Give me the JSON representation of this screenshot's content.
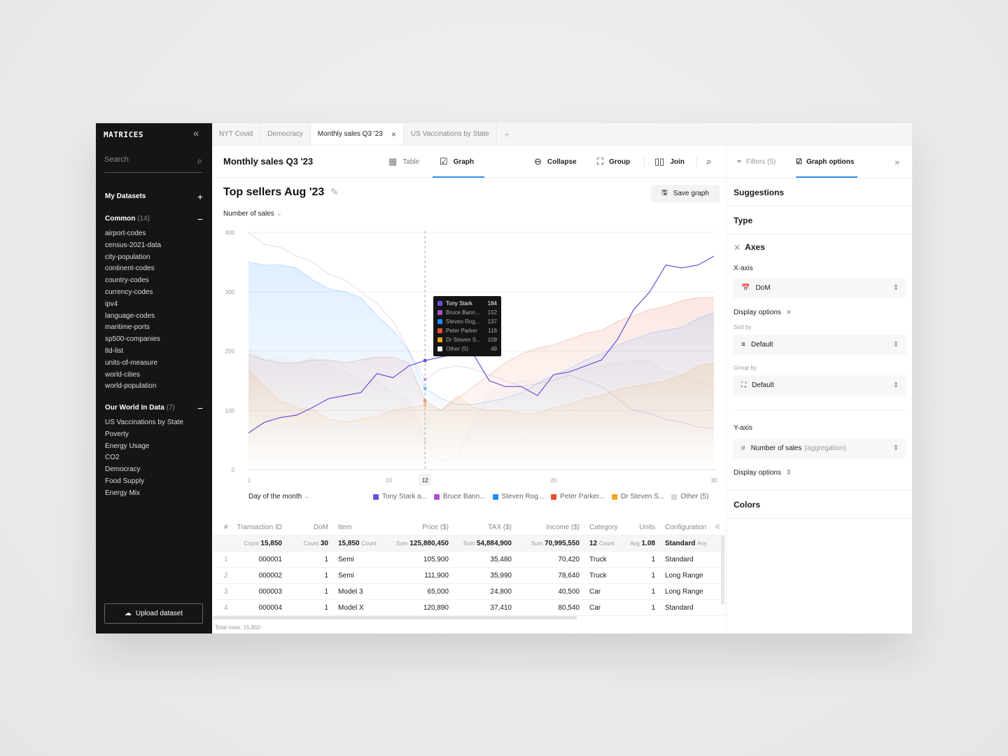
{
  "sidebar": {
    "logo": "MATRICES",
    "search_placeholder": "Search",
    "my_datasets": "My Datasets",
    "groups": [
      {
        "name": "Common",
        "count": "(14)",
        "items": [
          "airport-codes",
          "census-2021-data",
          "city-population",
          "continent-codes",
          "country-codes",
          "currency-codes",
          "ipv4",
          "language-codes",
          "maritime-ports",
          "sp500-companies",
          "tld-list",
          "units-of-measure",
          "world-cities",
          "world-population"
        ]
      },
      {
        "name": "Our World In Data",
        "count": "(7)",
        "items": [
          "US Vaccinations by State",
          "Poverty",
          "Energy Usage",
          "CO2",
          "Democracy",
          "Food Supply",
          "Energy Mix"
        ]
      }
    ],
    "upload": "Upload dataset"
  },
  "tabs": [
    "NYT Covid",
    "Democracy",
    "Monthly sales Q3 '23",
    "US Vaccinations by State"
  ],
  "header": {
    "title": "Monthly sales Q3 '23",
    "table": "Table",
    "graph": "Graph",
    "collapse": "Collapse",
    "group": "Group",
    "join": "Join"
  },
  "graph": {
    "title": "Top sellers Aug '23",
    "save": "Save graph",
    "y_selector": "Number of sales",
    "x_selector": "Day of the month"
  },
  "chart_data": {
    "type": "area",
    "ylim": [
      0,
      400
    ],
    "yticks": [
      "0",
      "100",
      "200",
      "300",
      "400"
    ],
    "xlim": [
      1,
      30
    ],
    "xticks": [
      "1",
      "10",
      "12",
      "20",
      "30"
    ],
    "highlight_x": 12,
    "grid": true,
    "legend": "bottom",
    "x": [
      1,
      2,
      3,
      4,
      5,
      6,
      7,
      8,
      9,
      10,
      11,
      12,
      13,
      14,
      15,
      16,
      17,
      18,
      19,
      20,
      21,
      22,
      23,
      24,
      25,
      26,
      27,
      28,
      29,
      30
    ],
    "series": [
      {
        "name": "Tony Stark",
        "legend": "Tony Stark a...",
        "tip": "Tony Stark",
        "color": "#6a4fd8",
        "values": [
          62,
          80,
          88,
          92,
          105,
          120,
          125,
          130,
          162,
          155,
          175,
          184,
          190,
          195,
          195,
          150,
          140,
          140,
          125,
          160,
          165,
          175,
          185,
          220,
          270,
          300,
          345,
          340,
          345,
          360
        ]
      },
      {
        "name": "Bruce Banner",
        "legend": "Bruce Bann...",
        "tip": "Bruce Bann...",
        "color": "#b04fc8",
        "values": [
          400,
          380,
          375,
          360,
          350,
          330,
          320,
          300,
          280,
          250,
          200,
          152,
          170,
          175,
          170,
          160,
          150,
          140,
          145,
          150,
          160,
          150,
          140,
          120,
          100,
          95,
          85,
          80,
          72,
          70
        ]
      },
      {
        "name": "Steven Rogers",
        "legend": "Steven Rog...",
        "tip": "Steven Rog...",
        "color": "#1a8cff",
        "values": [
          350,
          345,
          345,
          340,
          320,
          305,
          300,
          290,
          260,
          235,
          200,
          137,
          120,
          110,
          110,
          115,
          120,
          130,
          145,
          160,
          170,
          185,
          195,
          210,
          220,
          230,
          235,
          240,
          255,
          265
        ]
      },
      {
        "name": "Peter Parker",
        "legend": "Peter Parker...",
        "tip": "Peter Parker",
        "color": "#e5502e",
        "values": [
          195,
          185,
          180,
          180,
          185,
          185,
          180,
          185,
          190,
          190,
          180,
          116,
          100,
          120,
          140,
          160,
          180,
          195,
          205,
          210,
          220,
          230,
          235,
          250,
          260,
          270,
          275,
          285,
          290,
          290
        ]
      },
      {
        "name": "Dr Steven Strange",
        "legend": "Dr Steven S...",
        "tip": "Dr Steven S...",
        "color": "#f5a623",
        "values": [
          168,
          140,
          115,
          105,
          100,
          85,
          80,
          85,
          90,
          100,
          105,
          109,
          100,
          125,
          105,
          100,
          100,
          95,
          95,
          105,
          110,
          120,
          125,
          135,
          140,
          145,
          150,
          160,
          175,
          180
        ]
      },
      {
        "name": "Other (5)",
        "legend": "Other (5)",
        "tip": "Other (5)",
        "color": "#d8d8d8",
        "values": [
          205,
          185,
          190,
          180,
          190,
          175,
          165,
          150,
          150,
          130,
          120,
          49,
          15,
          20,
          80,
          130,
          140,
          150,
          150,
          155,
          165,
          170,
          175,
          180,
          185,
          185,
          165,
          160,
          150,
          140
        ]
      }
    ],
    "tooltip_values": [
      "184",
      "152",
      "137",
      "116",
      "109",
      "49"
    ]
  },
  "table": {
    "headers": [
      "#",
      "Transaction ID",
      "DoM",
      "Item",
      "Price ($)",
      "TAX ($)",
      "Income ($)",
      "Category",
      "Units",
      "Configuration"
    ],
    "summary": [
      [
        "Count",
        "15,850"
      ],
      [
        "Count",
        "30"
      ],
      [
        "15,850",
        "Count"
      ],
      [
        "Sum",
        "125,880,450"
      ],
      [
        "Sum",
        "54,884,900"
      ],
      [
        "Sum",
        "70,995,550"
      ],
      [
        "12",
        "Count"
      ],
      [
        "Avg",
        "1.08"
      ],
      [
        "Standard",
        "Any"
      ]
    ],
    "rows": [
      [
        "1",
        "000001",
        "1",
        "Semi",
        "105,900",
        "35,480",
        "70,420",
        "Truck",
        "1",
        "Standard"
      ],
      [
        "2",
        "000002",
        "1",
        "Semi",
        "111,900",
        "35,990",
        "78,640",
        "Truck",
        "1",
        "Long Range"
      ],
      [
        "3",
        "000003",
        "1",
        "Model 3",
        "65,000",
        "24,800",
        "40,500",
        "Car",
        "1",
        "Long Range"
      ],
      [
        "4",
        "000004",
        "1",
        "Model X",
        "120,890",
        "37,410",
        "80,540",
        "Car",
        "1",
        "Standard"
      ]
    ],
    "total": "Total rows: 15,850"
  },
  "panel": {
    "filters": "Filters (5)",
    "graph_options": "Graph options",
    "suggestions": "Suggestions",
    "type": "Type",
    "axes": "Axes",
    "x_axis": "X-axis",
    "x_value": "DoM",
    "display_options": "Display options",
    "sort_by": "Sort by",
    "sort_value": "Default",
    "group_by": "Group by",
    "group_value": "Default",
    "y_axis": "Y-axis",
    "y_value": "Number of sales",
    "y_suffix": "(aggregation)",
    "display_options2": "Display options",
    "colors": "Colors"
  }
}
